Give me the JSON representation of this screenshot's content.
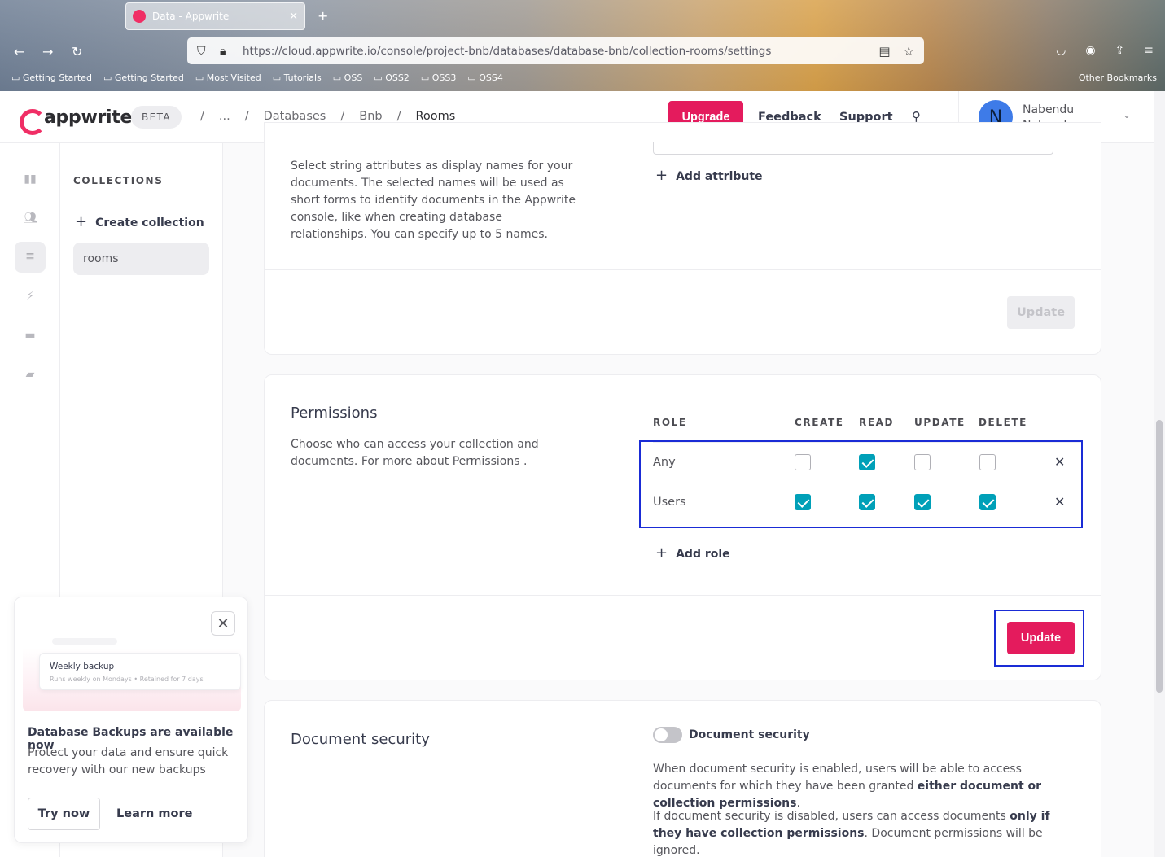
{
  "browser": {
    "tab_title": "Data - Appwrite",
    "url": "https://cloud.appwrite.io/console/project-bnb/databases/database-bnb/collection-rooms/settings",
    "bookmarks": [
      "Getting Started",
      "Getting Started",
      "Most Visited",
      "Tutorials",
      "OSS",
      "OSS2",
      "OSS3",
      "OSS4"
    ],
    "other_bookmarks": "Other Bookmarks"
  },
  "header": {
    "logo": "appwrite",
    "beta": "BETA",
    "breadcrumbs": [
      "/",
      "...",
      "/",
      "Databases",
      "/",
      "Bnb",
      "/",
      "Rooms"
    ],
    "upgrade": "Upgrade",
    "feedback": "Feedback",
    "support": "Support",
    "user_initial": "N",
    "user_name": "Nabendu",
    "user_sub": "Nabendu"
  },
  "collections": {
    "title": "COLLECTIONS",
    "create": "Create collection",
    "items": [
      "rooms"
    ]
  },
  "display_names": {
    "description": "Select string attributes as display names for your documents. The selected names will be used as short forms to identify documents in the Appwrite console, like when creating database relationships. You can specify up to 5 names.",
    "add_attribute": "Add attribute",
    "update": "Update"
  },
  "permissions": {
    "title": "Permissions",
    "desc_prefix": "Choose who can access your collection and documents. For more about ",
    "desc_link": "Permissions ",
    "desc_suffix": ".",
    "headers": [
      "ROLE",
      "CREATE",
      "READ",
      "UPDATE",
      "DELETE"
    ],
    "rows": [
      {
        "role": "Any",
        "create": false,
        "read": true,
        "update": false,
        "delete": false
      },
      {
        "role": "Users",
        "create": true,
        "read": true,
        "update": true,
        "delete": true
      }
    ],
    "add_role": "Add role",
    "update": "Update"
  },
  "document_security": {
    "title": "Document security",
    "toggle_label": "Document security",
    "enabled": false,
    "p1_a": "When document security is enabled, users will be able to access documents for which they have been granted ",
    "p1_b": "either document or collection permissions",
    "p1_c": ".",
    "p2_a": "If document security is disabled, users can access documents ",
    "p2_b": "only if they have collection permissions",
    "p2_c": ". Document permissions will be ignored."
  },
  "promo": {
    "card_title": "Weekly backup",
    "card_sub": "Runs weekly on Mondays  •  Retained for 7 days",
    "title": "Database Backups are available now",
    "text": "Protect your data and ensure quick recovery with our new backups",
    "try_now": "Try now",
    "learn_more": "Learn more"
  },
  "colors": {
    "accent": "#e41b5d",
    "checkbox": "#00a0b8",
    "highlight": "#1a2cd6"
  }
}
